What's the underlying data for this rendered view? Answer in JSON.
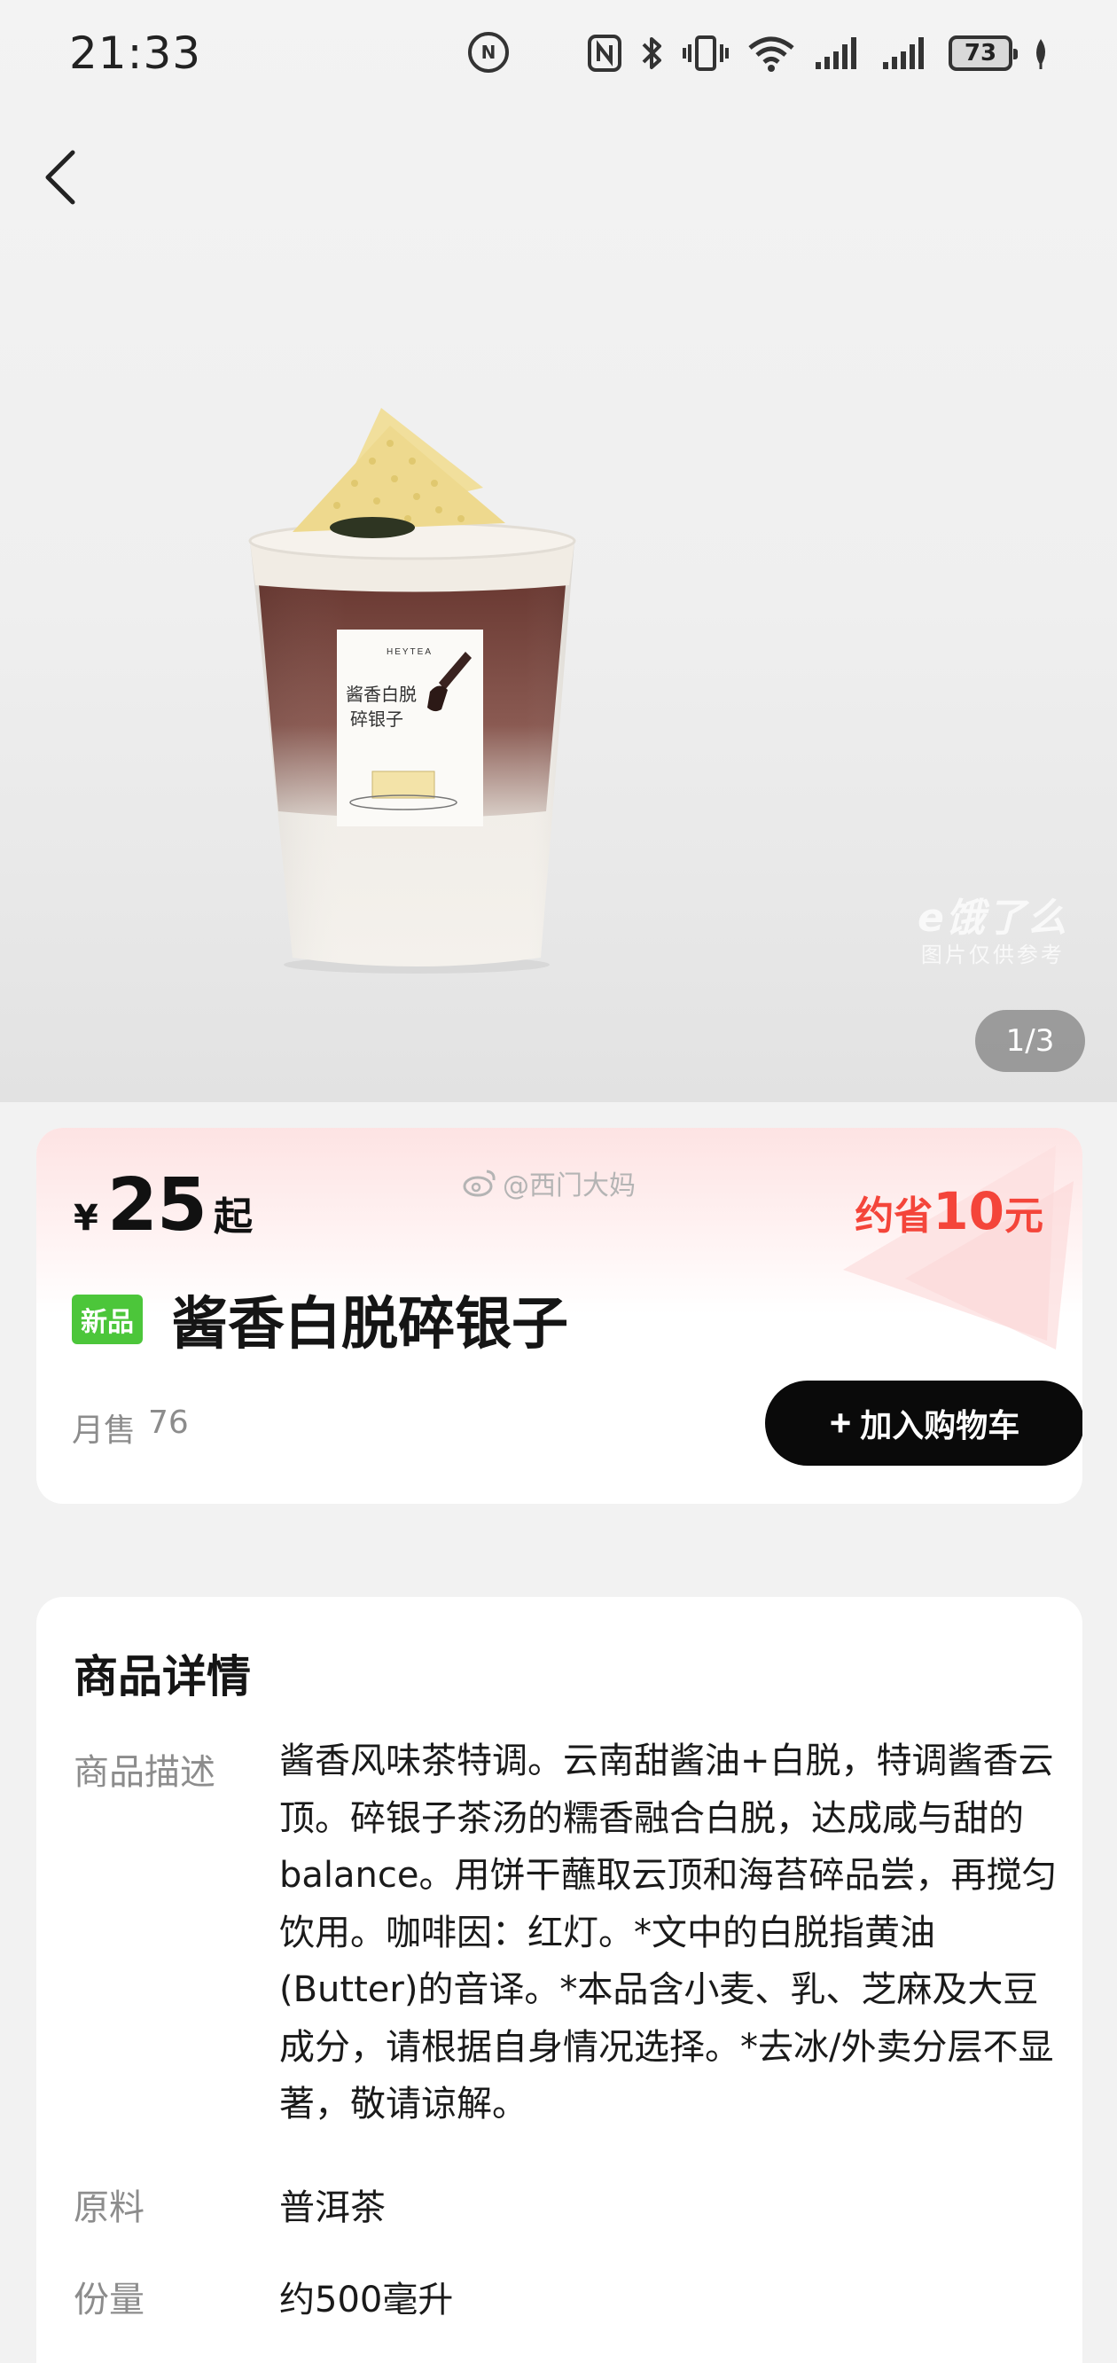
{
  "status_bar": {
    "time": "21:33",
    "app_icon_text": "N",
    "battery": "73",
    "icons": [
      "app-notification-icon",
      "nfc-icon",
      "bluetooth-icon",
      "vibrate-icon",
      "wifi-icon",
      "signal-icon",
      "signal-icon",
      "battery-icon",
      "leaf-icon"
    ]
  },
  "gallery": {
    "page_indicator": "1/3",
    "watermark_line1": "e饿了么",
    "watermark_line2": "图片仅供参考",
    "cup_brand": "HEYTEA",
    "cup_label_line1": "酱香白脱",
    "cup_label_line2": "碎银子"
  },
  "product": {
    "currency": "¥",
    "price": "25",
    "price_suffix": "起",
    "post_watermark": "@西门大妈",
    "savings_prefix": "约省",
    "savings_amount": "10",
    "savings_suffix": "元",
    "new_badge": "新品",
    "name": "酱香白脱碎银子",
    "monthly_sales_label": "月售",
    "monthly_sales_count": "76",
    "add_to_cart_plus": "+",
    "add_to_cart_label": "加入购物车"
  },
  "details": {
    "title": "商品详情",
    "description_label": "商品描述",
    "description": "酱香风味茶特调。云南甜酱油+白脱，特调酱香云顶。碎银子茶汤的糯香融合白脱，达成咸与甜的balance。用饼干蘸取云顶和海苔碎品尝，再搅匀饮用。咖啡因：红灯。*文中的白脱指黄油(Butter)的音译。*本品含小麦、乳、芝麻及大豆成分，请根据自身情况选择。*去冰/外卖分层不显著，敬请谅解。",
    "ingredient_label": "原料",
    "ingredient_value": "普洱茶",
    "volume_label": "份量",
    "volume_value": "约500毫升"
  },
  "colors": {
    "accent_red": "#f4453a",
    "new_badge_green": "#4cc63a",
    "button_black": "#0a0a0a"
  }
}
